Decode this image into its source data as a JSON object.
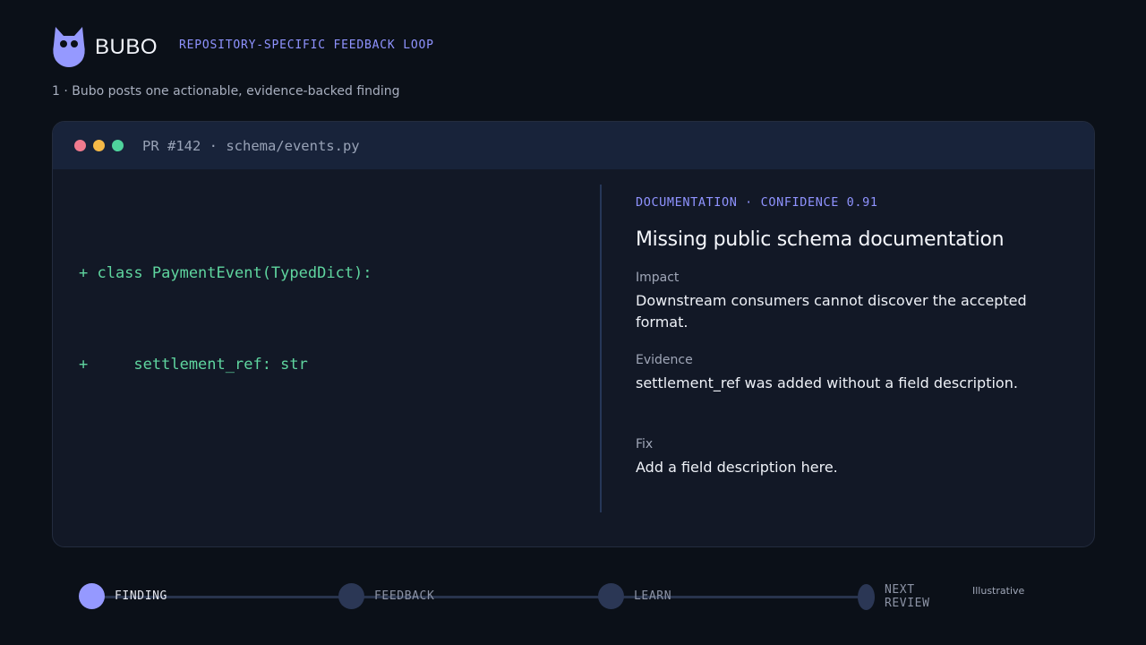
{
  "header": {
    "brand": "BUBO",
    "tagline": "REPOSITORY-SPECIFIC FEEDBACK LOOP"
  },
  "step_caption": "1 · Bubo posts one actionable, evidence-backed finding",
  "panel": {
    "title": "PR #142 · schema/events.py",
    "code_lines": [
      "+ class PaymentEvent(TypedDict):",
      "+     settlement_ref: str"
    ]
  },
  "finding": {
    "meta": "DOCUMENTATION · CONFIDENCE 0.91",
    "title": "Missing public schema documentation",
    "impact_label": "Impact",
    "impact_text": "Downstream consumers cannot discover the accepted format.",
    "evidence_label": "Evidence",
    "evidence_text": "settlement_ref was added without a field description.",
    "fix_label": "Fix",
    "fix_text": "Add a field description here."
  },
  "stepper": {
    "steps": [
      {
        "label": "FINDING",
        "active": true
      },
      {
        "label": "FEEDBACK",
        "active": false
      },
      {
        "label": "LEARN",
        "active": false
      },
      {
        "label": "NEXT REVIEW",
        "active": false
      }
    ],
    "illustrative": "Illustrative"
  },
  "colors": {
    "accent": "#9599ff",
    "code_green": "#5fd59f",
    "background": "#0b1018"
  }
}
